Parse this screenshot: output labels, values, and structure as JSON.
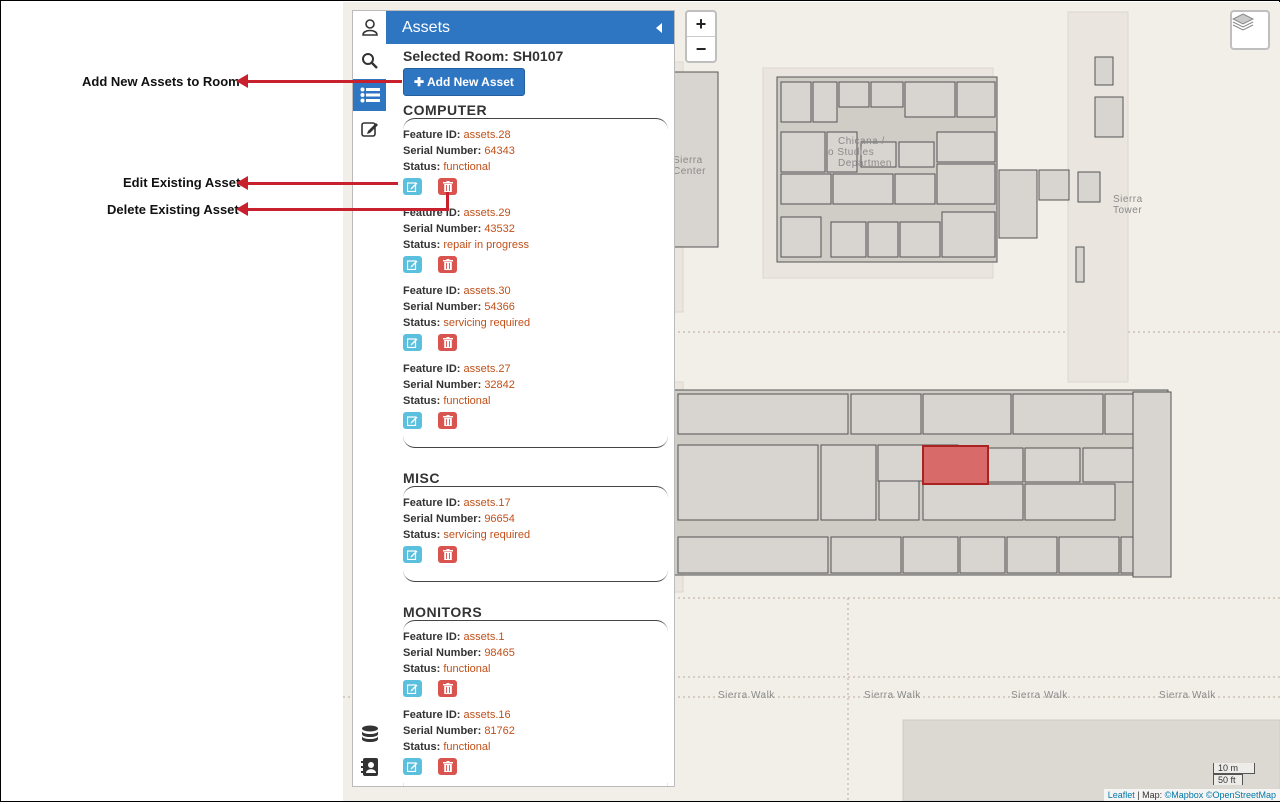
{
  "annotations": {
    "add": "Add New Assets to Room",
    "edit": "Edit Existing Asset",
    "delete": "Delete Existing Asset"
  },
  "colors": {
    "accent": "#2e75c2",
    "edit": "#5bc0de",
    "delete": "#d9534f",
    "value": "#c0501a",
    "selected_room": "#d96a6a"
  },
  "sidebar": {
    "tabs": [
      "user-icon",
      "search-icon",
      "list-icon",
      "edit-icon",
      "database-icon",
      "contacts-icon"
    ],
    "active_tab": "list-icon"
  },
  "panel": {
    "title": "Assets",
    "selected_room": "Selected Room: SH0107",
    "add_button": "Add New Asset",
    "labels": {
      "feature_id": "Feature ID:",
      "serial": "Serial Number:",
      "status": "Status:"
    },
    "categories": [
      {
        "name": "COMPUTER",
        "assets": [
          {
            "feature_id": "assets.28",
            "serial": "64343",
            "status": "functional"
          },
          {
            "feature_id": "assets.29",
            "serial": "43532",
            "status": "repair in progress"
          },
          {
            "feature_id": "assets.30",
            "serial": "54366",
            "status": "servicing required"
          },
          {
            "feature_id": "assets.27",
            "serial": "32842",
            "status": "functional"
          }
        ]
      },
      {
        "name": "MISC",
        "assets": [
          {
            "feature_id": "assets.17",
            "serial": "96654",
            "status": "servicing required"
          }
        ]
      },
      {
        "name": "MONITORS",
        "assets": [
          {
            "feature_id": "assets.1",
            "serial": "98465",
            "status": "functional"
          },
          {
            "feature_id": "assets.16",
            "serial": "81762",
            "status": "functional"
          }
        ]
      }
    ]
  },
  "map": {
    "zoom_in": "+",
    "zoom_out": "−",
    "labels": {
      "walk": "Sierra Walk",
      "tower_1": "Sierra",
      "tower_2": "Tower",
      "studies_1": "Chicana /",
      "studies_2": "o Studies",
      "studies_3": "Departmen",
      "center_1": "Sierra",
      "center_2": "Center"
    },
    "scale": {
      "metric": "10 m",
      "imperial": "50 ft"
    },
    "attribution": {
      "leaflet": "Leaflet",
      "sep": " | Map: ",
      "mapbox": "©Mapbox",
      "osm": "©OpenStreetMap"
    }
  }
}
